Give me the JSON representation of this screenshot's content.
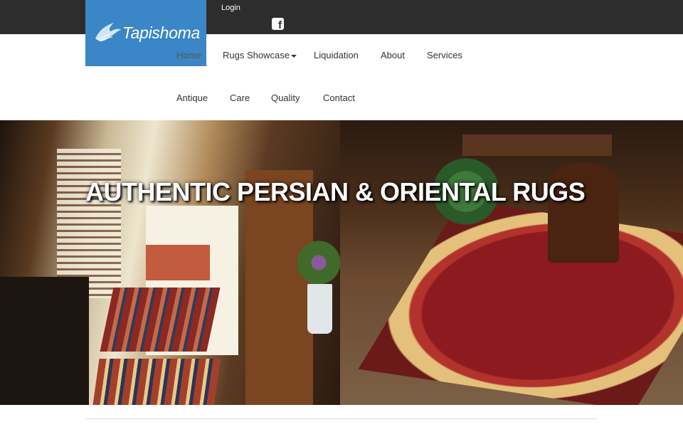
{
  "header": {
    "login_label": "Login",
    "social": [
      {
        "name": "facebook",
        "icon": "facebook-icon"
      }
    ],
    "topbar_color": "#2d2d2d"
  },
  "logo": {
    "text": "Tapishoma",
    "icon": "bird-icon",
    "background": "#3a86c6"
  },
  "nav": {
    "row1": [
      {
        "label": "Home",
        "active": true
      },
      {
        "label": "Rugs Showcase",
        "dropdown": true
      },
      {
        "label": "Liquidation"
      },
      {
        "label": "About"
      },
      {
        "label": "Services"
      }
    ],
    "row2": [
      {
        "label": "Antique"
      },
      {
        "label": "Care"
      },
      {
        "label": "Quality"
      },
      {
        "label": "Contact"
      }
    ]
  },
  "hero": {
    "title": "AUTHENTIC PERSIAN & ORIENTAL RUGS"
  }
}
